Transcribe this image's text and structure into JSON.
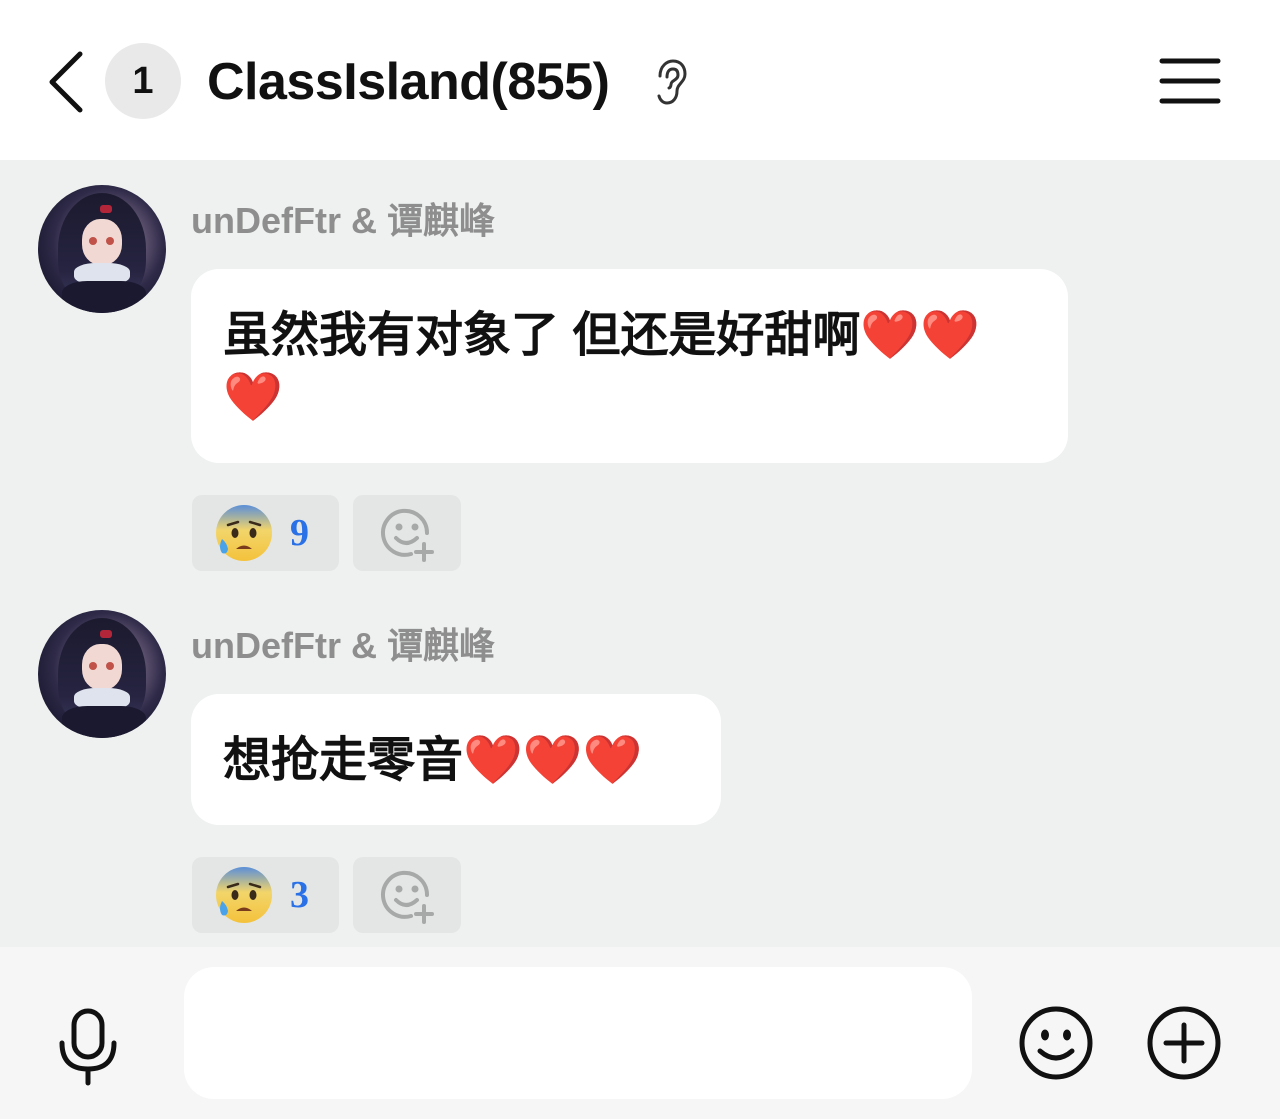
{
  "header": {
    "unread_count": "1",
    "title": "ClassIsland(855)",
    "icons": [
      "chevron-left-icon",
      "ear-icon",
      "hamburger-menu-icon"
    ]
  },
  "messages": [
    {
      "sender": "unDefFtr & 谭麒峰",
      "text": "虽然我有对象了 但还是好甜啊",
      "hearts": "❤️❤️❤️",
      "reaction": {
        "emoji": "anxious-face-with-sweat",
        "count": "9"
      }
    },
    {
      "sender": "unDefFtr & 谭麒峰",
      "text": "想抢走零音",
      "hearts": "❤️❤️❤️",
      "reaction": {
        "emoji": "anxious-face-with-sweat",
        "count": "3"
      }
    }
  ],
  "input": {
    "value": "",
    "placeholder": ""
  },
  "colors": {
    "background": "#eef1ef",
    "bubble": "#ffffff",
    "heart": "#e8131f",
    "reaction_count": "#2a70e6",
    "sender_name": "#8e8e8e"
  }
}
